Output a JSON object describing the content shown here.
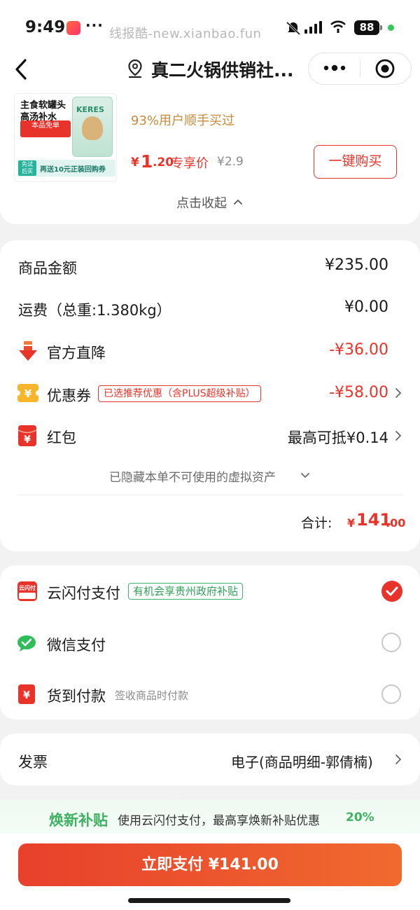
{
  "status": {
    "time": "9:49",
    "dots": "···",
    "battery": "88"
  },
  "watermark": "线报酷-new.xianbao.fun",
  "nav": {
    "title": "真二火锅供销社...",
    "back_icon": "chevron-left-icon",
    "location_icon": "location-pin-icon",
    "more_icon": "more-dots-icon",
    "close_icon": "target-close-icon"
  },
  "promo": {
    "image": {
      "line1": "主食软罐头",
      "line2": "高汤补水",
      "badge": "本品免单",
      "brand": "KERES",
      "bar_left": "先试 后买",
      "bar_text": "再送10元正装回购券"
    },
    "buyers": "93%用户顺手买过",
    "price_symbol": "¥",
    "price_int": "1",
    "price_dec": ".20",
    "price_tag": "专享价",
    "original_price": "¥2.9",
    "buy_button": "一键购买",
    "collapse": "点击收起"
  },
  "summary": {
    "goods_label": "商品金额",
    "goods_value": "¥235.00",
    "shipping_label": "运费（总重:1.380kg）",
    "shipping_value": "¥0.00",
    "drop_label": "官方直降",
    "drop_value": "-¥36.00",
    "coupon_label": "优惠券",
    "coupon_tag": "已选推荐优惠（含PLUS超级补贴）",
    "coupon_value": "-¥58.00",
    "redpacket_label": "红包",
    "redpacket_value": "最高可抵¥0.14",
    "hidden_note": "已隐藏本单不可使用的虚拟资产",
    "total_label": "合计:",
    "total_symbol": "¥",
    "total_int": "141",
    "total_dec": ".00"
  },
  "payment": {
    "unionpay_label": "云闪付支付",
    "unionpay_icon_text": "云闪付",
    "unionpay_tag": "有机会享贵州政府补贴",
    "unionpay_selected": true,
    "wechat_label": "微信支付",
    "cod_label": "货到付款",
    "cod_note": "签收商品时付款"
  },
  "invoice": {
    "label": "发票",
    "value": "电子(商品明细-郭倩楠)"
  },
  "subsidy": {
    "title": "焕新补贴",
    "text": "使用云闪付支付，最高享焕新补贴优惠",
    "percent": "20%"
  },
  "pay_button": "立即支付 ¥141.00",
  "colors": {
    "accent": "#e8332a",
    "green": "#3fb161",
    "gold": "#c98a3a"
  }
}
